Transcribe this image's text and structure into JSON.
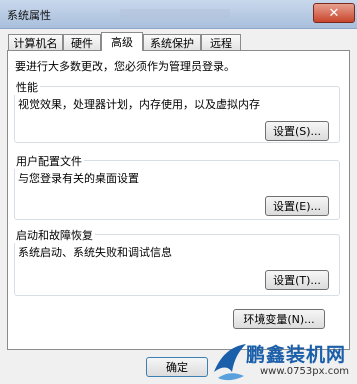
{
  "window": {
    "title": "系统属性"
  },
  "tabs": [
    "计算机名",
    "硬件",
    "高级",
    "系统保护",
    "远程"
  ],
  "admin_note": "要进行大多数更改，您必须作为管理员登录。",
  "performance": {
    "title": "性能",
    "desc": "视觉效果，处理器计划，内存使用，以及虚拟内存",
    "button": "设置(S)..."
  },
  "user_profile": {
    "title": "用户配置文件",
    "desc": "与您登录有关的桌面设置",
    "button": "设置(E)..."
  },
  "startup": {
    "title": "启动和故障恢复",
    "desc": "系统启动、系统失败和调试信息",
    "button": "设置(T)..."
  },
  "env_button": "环境变量(N)...",
  "ok_button": "确定",
  "watermark": {
    "brand": "鹏鑫装机网",
    "url": "www.0753px.com"
  },
  "colors": {
    "titlebar": "#b8cbe4",
    "close": "#c8452c",
    "brand": "#1b5faa"
  }
}
